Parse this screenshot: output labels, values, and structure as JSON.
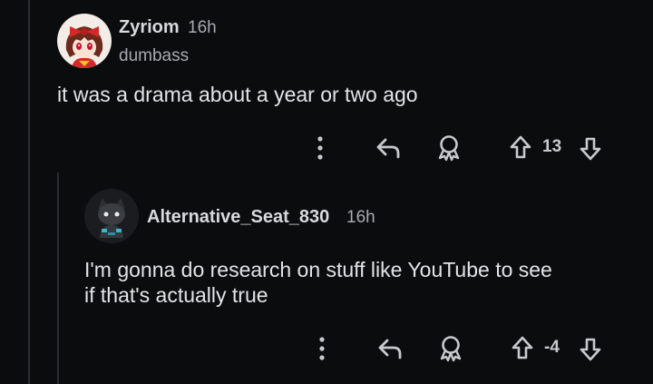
{
  "comments": [
    {
      "username": "Zyriom",
      "time": "16h",
      "flair": "dumbass",
      "body": "it was a drama about a year or two ago",
      "score": "13",
      "avatar_icon": "reimu-avatar-icon"
    },
    {
      "username": "Alternative_Seat_830",
      "time": "16h",
      "body_line1": "I'm gonna do research on stuff like YouTube to see",
      "body_line2": "if that's actually true",
      "score": "-4",
      "avatar_icon": "snoo-avatar-icon"
    }
  ],
  "icons": {
    "more": "more-options-icon",
    "reply": "reply-icon",
    "award": "award-icon",
    "upvote": "upvote-icon",
    "downvote": "downvote-icon"
  },
  "colors": {
    "background": "#0b0c0e",
    "text": "#d7dadc",
    "muted": "#a6abb0",
    "thread_line": "#2a2d31"
  }
}
